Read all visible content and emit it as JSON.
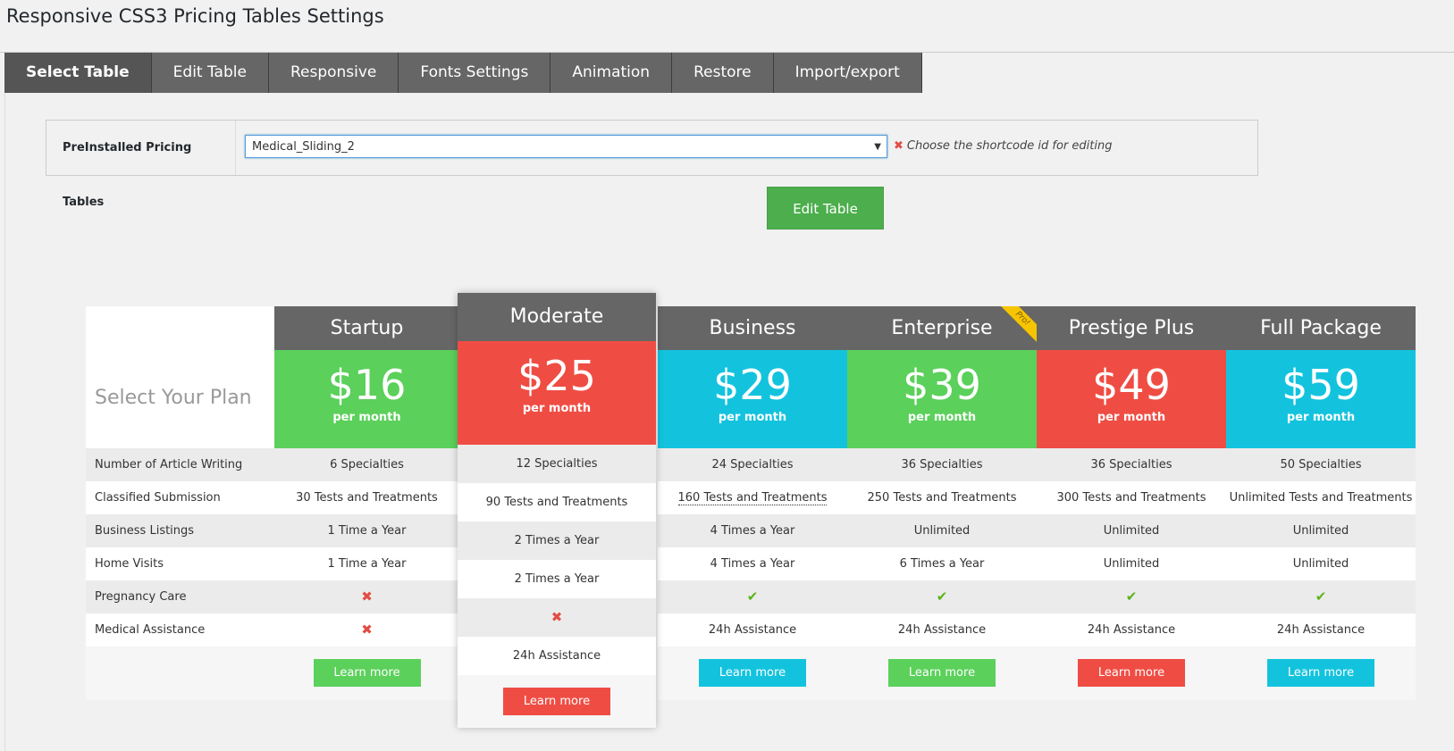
{
  "page": {
    "title": "Responsive CSS3 Pricing Tables Settings"
  },
  "tabs": [
    {
      "label": "Select Table"
    },
    {
      "label": "Edit Table"
    },
    {
      "label": "Responsive"
    },
    {
      "label": "Fonts Settings"
    },
    {
      "label": "Animation"
    },
    {
      "label": "Restore"
    },
    {
      "label": "Import/export"
    }
  ],
  "selector": {
    "label": "PreInstalled Pricing Tables",
    "value": "Medical_Sliding_2",
    "hint": "Choose the shortcode id for editing",
    "button": "Edit Table"
  },
  "colors": {
    "green": "#5bd05b",
    "red": "#ef4d44",
    "cyan": "#13c3de",
    "header": "#666666"
  },
  "features": {
    "title": "Select Your Plan",
    "rows": [
      "Number of Article Writing",
      "Classified Submission",
      "Business Listings",
      "Home Visits",
      "Pregnancy Care",
      "Medical Assistance"
    ]
  },
  "plans": [
    {
      "name": "Startup",
      "price": "$16",
      "period": "per month",
      "color": "#5bd05b",
      "button": "Learn more",
      "values": [
        "6 Specialties",
        "30 Tests and Treatments",
        "1 Time a Year",
        "1 Time a Year",
        "x-mark",
        "x-mark"
      ]
    },
    {
      "name": "Moderate",
      "price": "$25",
      "period": "per month",
      "color": "#ef4d44",
      "button": "Learn more",
      "values": [
        "12 Specialties",
        "90 Tests and Treatments",
        "2 Times a Year",
        "2 Times a Year",
        "x-mark",
        "24h Assistance"
      ]
    },
    {
      "name": "Business",
      "price": "$29",
      "period": "per month",
      "color": "#13c3de",
      "button": "Learn more",
      "values": [
        "24 Specialties",
        "160 Tests and Treatments",
        "4 Times a Year",
        "4 Times a Year",
        "check-mark",
        "24h Assistance"
      ]
    },
    {
      "name": "Enterprise",
      "price": "$39",
      "period": "per month",
      "color": "#5bd05b",
      "button": "Learn more",
      "ribbon": "Pro!",
      "values": [
        "36 Specialties",
        "250 Tests and Treatments",
        "Unlimited",
        "6 Times a Year",
        "check-mark",
        "24h Assistance"
      ]
    },
    {
      "name": "Prestige Plus",
      "price": "$49",
      "period": "per month",
      "color": "#ef4d44",
      "button": "Learn more",
      "values": [
        "36 Specialties",
        "300 Tests and Treatments",
        "Unlimited",
        "Unlimited",
        "check-mark",
        "24h Assistance"
      ]
    },
    {
      "name": "Full Package",
      "price": "$59",
      "period": "per month",
      "color": "#13c3de",
      "button": "Learn more",
      "values": [
        "50 Specialties",
        "Unlimited Tests and Treatments",
        "Unlimited",
        "Unlimited",
        "check-mark",
        "24h Assistance"
      ]
    }
  ]
}
